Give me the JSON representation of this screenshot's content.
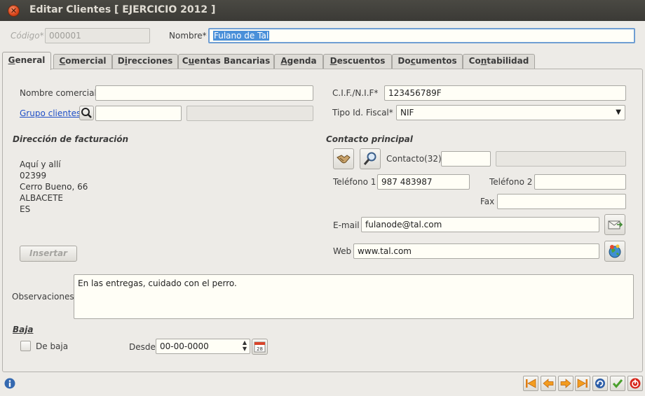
{
  "window": {
    "title": "Editar Clientes [ EJERCICIO 2012 ]"
  },
  "header": {
    "codigo_label": "Código*",
    "codigo_value": "000001",
    "nombre_label": "Nombre*",
    "nombre_value": "Fulano de Tal"
  },
  "tabs": [
    {
      "label": "General",
      "key": "G",
      "rest": "eneral"
    },
    {
      "label": "Comercial",
      "key": "C",
      "rest": "omercial"
    },
    {
      "label": "Direcciones",
      "pre": "D",
      "key": "i",
      "rest": "recciones"
    },
    {
      "label": "Cuentas Bancarias",
      "pre": "C",
      "key": "u",
      "rest": "entas Bancarias"
    },
    {
      "label": "Agenda",
      "key": "A",
      "rest": "genda"
    },
    {
      "label": "Descuentos",
      "key": "D",
      "rest": "escuentos"
    },
    {
      "label": "Documentos",
      "pre": "Do",
      "key": "c",
      "rest": "umentos"
    },
    {
      "label": "Contabilidad",
      "pre": "Co",
      "key": "n",
      "rest": "tabilidad"
    }
  ],
  "general": {
    "nombre_comercial_label": "Nombre comercial",
    "nombre_comercial_value": "",
    "grupo_clientes_label": "Grupo clientes",
    "grupo_value": "",
    "grupo_desc": "",
    "cif_label": "C.I.F./N.I.F*",
    "cif_value": "123456789F",
    "tipo_fiscal_label": "Tipo Id. Fiscal*",
    "tipo_fiscal_value": "NIF",
    "direccion_title": "Dirección de facturación",
    "direccion_lines": [
      "Aquí y allí",
      "02399",
      "Cerro Bueno, 66",
      "ALBACETE",
      "ES"
    ],
    "insertar_label": "Insertar",
    "contacto_title": "Contacto principal",
    "contacto_label": "Contacto(32)",
    "contacto_value": "",
    "contacto_desc": "",
    "telefono1_label": "Teléfono 1",
    "telefono1_value": "987 483987",
    "telefono2_label": "Teléfono 2",
    "telefono2_value": "",
    "fax_label": "Fax",
    "fax_value": "",
    "email_label": "E-mail",
    "email_value": "fulanode@tal.com",
    "web_label": "Web",
    "web_value": "www.tal.com",
    "observaciones_label": "Observaciones",
    "observaciones_value": "En las entregas, cuidado con el perro.",
    "baja_title": "Baja",
    "de_baja_label": "De baja",
    "desde_label": "Desde",
    "desde_value": "00-00-0000",
    "calendar_day": "28"
  },
  "colors": {
    "accent": "#4a90d9",
    "titlebar": "#3c3b37",
    "close": "#e0582a",
    "link": "#1f4fc7"
  },
  "icons": [
    "close-icon",
    "search-icon",
    "handshake-icon",
    "magnifier-icon",
    "email-icon",
    "web-icon",
    "calendar-icon",
    "info-icon",
    "first-icon",
    "prev-icon",
    "next-icon",
    "last-icon",
    "refresh-icon",
    "accept-icon",
    "exit-icon"
  ]
}
